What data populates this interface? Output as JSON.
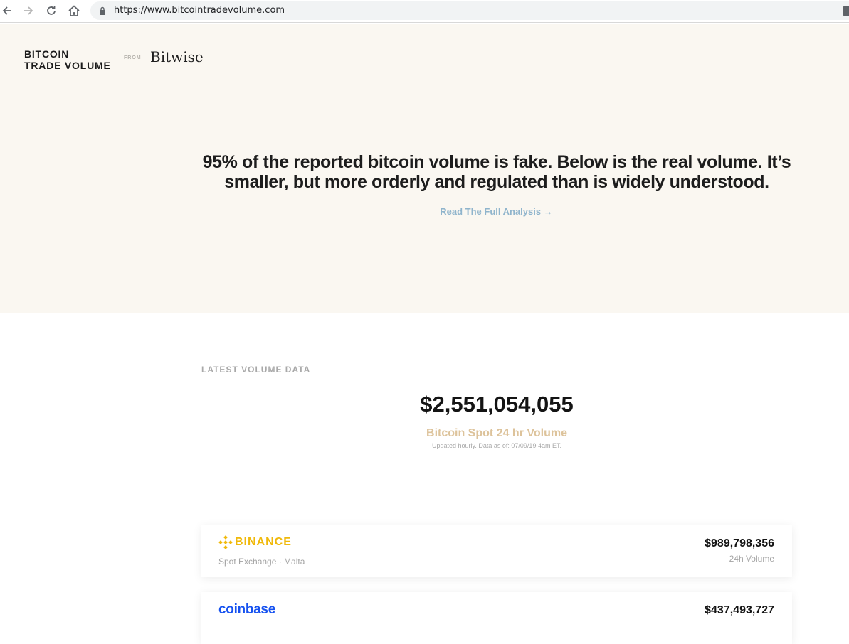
{
  "browser": {
    "url": "https://www.bitcointradevolume.com"
  },
  "header": {
    "logo_line1": "BITCOIN",
    "logo_line2": "TRADE VOLUME",
    "from_label": "FROM",
    "partner_logo": "Bitwise"
  },
  "hero": {
    "headline": "95% of the reported bitcoin volume is fake. Below is the real volume. It’s smaller, but more orderly and regulated than is widely understood.",
    "link_text": "Read The Full Analysis →"
  },
  "volume": {
    "section_label": "LATEST VOLUME DATA",
    "total": "$2,551,054,055",
    "total_label": "Bitcoin Spot 24 hr Volume",
    "updated_note": "Updated hourly. Data as of: 07/09/19 4am ET."
  },
  "exchanges": [
    {
      "name": "BINANCE",
      "subtitle": "Spot Exchange · Malta",
      "volume": "$989,798,356",
      "volume_label": "24h Volume",
      "brand_color": "#f0b90b"
    },
    {
      "name": "coinbase",
      "volume": "$437,493,727",
      "brand_color": "#1652f0"
    }
  ],
  "colors": {
    "hero_bg": "#faf7f1",
    "link": "#8fb4cc",
    "accent_gold": "#ddc39b"
  }
}
